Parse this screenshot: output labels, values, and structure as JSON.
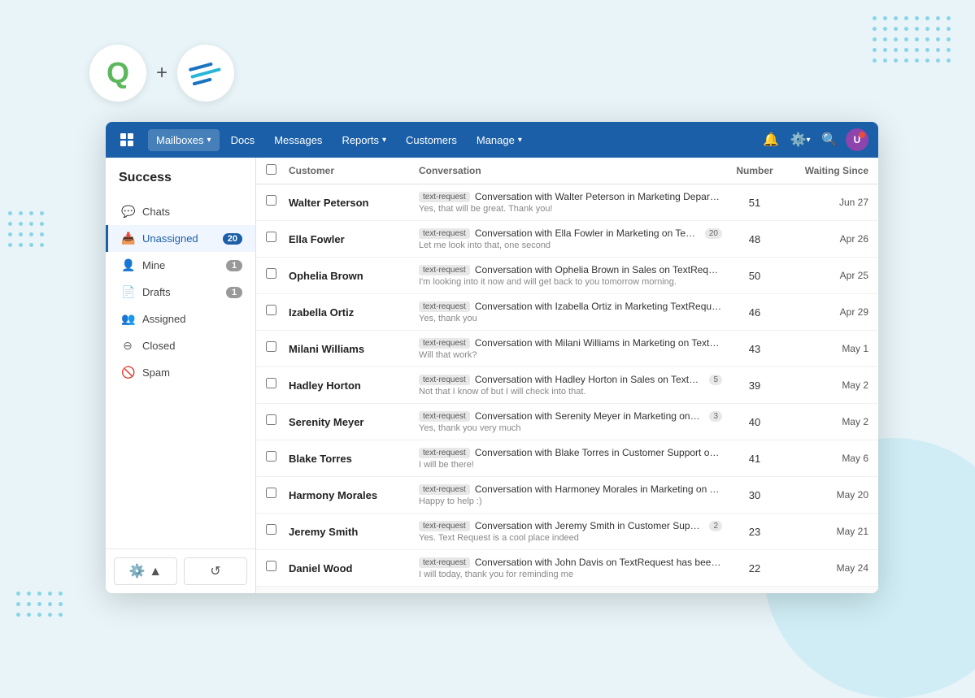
{
  "branding": {
    "logo_q": "Q",
    "logo_plus": "+",
    "accent_color": "#1a5fa8",
    "dot_color": "#29b6d8"
  },
  "nav": {
    "mailboxes_label": "Mailboxes",
    "docs_label": "Docs",
    "messages_label": "Messages",
    "reports_label": "Reports",
    "customers_label": "Customers",
    "manage_label": "Manage"
  },
  "sidebar": {
    "title": "Success",
    "items": [
      {
        "label": "Chats",
        "icon": "💬",
        "active": false,
        "badge": null
      },
      {
        "label": "Unassigned",
        "icon": "📥",
        "active": true,
        "badge": "20"
      },
      {
        "label": "Mine",
        "icon": "👤",
        "active": false,
        "badge": "1"
      },
      {
        "label": "Drafts",
        "icon": "📄",
        "active": false,
        "badge": "1"
      },
      {
        "label": "Assigned",
        "icon": "👥",
        "active": false,
        "badge": null
      },
      {
        "label": "Closed",
        "icon": "⊖",
        "active": false,
        "badge": null
      },
      {
        "label": "Spam",
        "icon": "🚫",
        "active": false,
        "badge": null
      }
    ]
  },
  "table": {
    "headers": {
      "customer": "Customer",
      "conversation": "Conversation",
      "number": "Number",
      "waiting_since": "Waiting Since"
    },
    "rows": [
      {
        "customer": "Walter Peterson",
        "tag": "text-request",
        "conv_title": "Conversation with Walter Peterson in Marketing Departme...",
        "conv_preview": "Yes, that will be great. Thank you!",
        "badge": null,
        "number": "51",
        "waiting": "Jun 27"
      },
      {
        "customer": "Ella Fowler",
        "tag": "text-request",
        "conv_title": "Conversation with Ella Fowler in Marketing on TextRequ...",
        "conv_preview": "Let me look into that, one second",
        "badge": "20",
        "number": "48",
        "waiting": "Apr 26"
      },
      {
        "customer": "Ophelia Brown",
        "tag": "text-request",
        "conv_title": "Conversation with Ophelia Brown in Sales on TextRequest",
        "conv_preview": "I'm looking into it now and will get back to you tomorrow morning.",
        "badge": null,
        "number": "50",
        "waiting": "Apr 25"
      },
      {
        "customer": "Izabella Ortiz",
        "tag": "text-request",
        "conv_title": "Conversation with Izabella Ortiz in Marketing TextReques...",
        "conv_preview": "Yes, thank you",
        "badge": null,
        "number": "46",
        "waiting": "Apr 29"
      },
      {
        "customer": "Milani Williams",
        "tag": "text-request",
        "conv_title": "Conversation with Milani Williams in Marketing on TextReq...",
        "conv_preview": "Will that work?",
        "badge": null,
        "number": "43",
        "waiting": "May 1"
      },
      {
        "customer": "Hadley Horton",
        "tag": "text-request",
        "conv_title": "Conversation with Hadley Horton in Sales on TextRequest",
        "conv_preview": "Not that I know of but I will check into that.",
        "badge": "5",
        "number": "39",
        "waiting": "May 2"
      },
      {
        "customer": "Serenity Meyer",
        "tag": "text-request",
        "conv_title": "Conversation with Serenity Meyer in Marketing on TextRe...",
        "conv_preview": "Yes, thank you very much",
        "badge": "3",
        "number": "40",
        "waiting": "May 2"
      },
      {
        "customer": "Blake Torres",
        "tag": "text-request",
        "conv_title": "Conversation with Blake Torres in Customer Support on Te...",
        "conv_preview": "I will be there!",
        "badge": null,
        "number": "41",
        "waiting": "May 6"
      },
      {
        "customer": "Harmony Morales",
        "tag": "text-request",
        "conv_title": "Conversation with Harmoney Morales in Marketing on Text...",
        "conv_preview": "Happy to help :)",
        "badge": null,
        "number": "30",
        "waiting": "May 20"
      },
      {
        "customer": "Jeremy Smith",
        "tag": "text-request",
        "conv_title": "Conversation with Jeremy Smith in Customer Support on...",
        "conv_preview": "Yes. Text Request is a cool place indeed",
        "badge": "2",
        "number": "23",
        "waiting": "May 21"
      },
      {
        "customer": "Daniel Wood",
        "tag": "text-request",
        "conv_title": "Conversation with John Davis on TextRequest has been up...",
        "conv_preview": "I will today, thank you for reminding me",
        "badge": null,
        "number": "22",
        "waiting": "May 24"
      }
    ]
  }
}
